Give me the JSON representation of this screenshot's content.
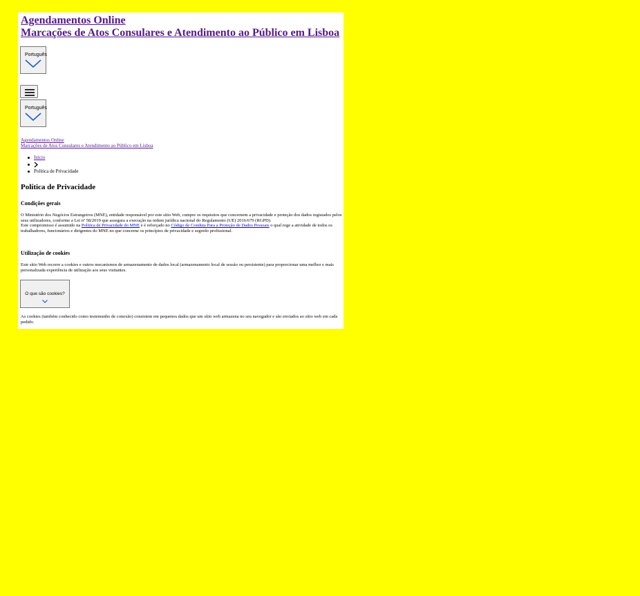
{
  "header": {
    "title_line1": "Agendamentos Online",
    "title_line2": "Marcações de Atos Consulares e Atendimento ao Público em Lisboa"
  },
  "language": {
    "selected": "Português"
  },
  "menu": {
    "icon": "hamburger-icon"
  },
  "small_links": {
    "line1": "Agendamentos Online",
    "line2": "Marcações de Atos Consulares e Atendimento ao Público em Lisboa"
  },
  "breadcrumb": {
    "home": "Início",
    "separator_icon": "chevron-right-icon",
    "current": "Política de Privacidade"
  },
  "main": {
    "title": "Política de Privacidade",
    "sections": [
      {
        "heading": "Condições gerais",
        "para1": "O Ministério dos Negócios Estrangeiros (MNE), entidade responsável por este sítio Web, cumpre os requisitos que concernem a privacidade e proteção dos dados registados pelos seus utilizadores, conforme a Lei nº 58/2019 que assegura a execução na ordem jurídica nacional do Regulamento (UE) 2016/679 (RGPD).",
        "para2_before": "Este compromisso é assumido na ",
        "link1": "Política de Privacidade do MNE",
        "para2_middle": " e é reforçado no ",
        "link2": "Código de Conduta Para a Proteção de Dados Pessoais",
        "para2_after": " o qual rege a atividade de todos os trabalhadores, funcionários e dirigentes do MNE no que concerne os princípios de privacidade e segredo profissional."
      },
      {
        "heading": "Utilização de cookies",
        "para": "Este sítio Web recorre a cookies e outros mecanismos de armazenamento de dados local (armazenamento local de sessão ou persistente) para proporcionar uma melhor e mais personalizada experiência de utilização aos seus visitantes.",
        "button": "O que são cookies?",
        "after_para": "As cookies (também conhecido como testemunho de conexão) consistem em pequenos dados que um sítio web armazena no seu navegador e são enviados ao sítio web em cada pedido."
      }
    ]
  },
  "colors": {
    "background": "#ffff00",
    "visited_link": "#551a8b",
    "link": "#0000ee",
    "chevron": "#1a5fd0"
  }
}
